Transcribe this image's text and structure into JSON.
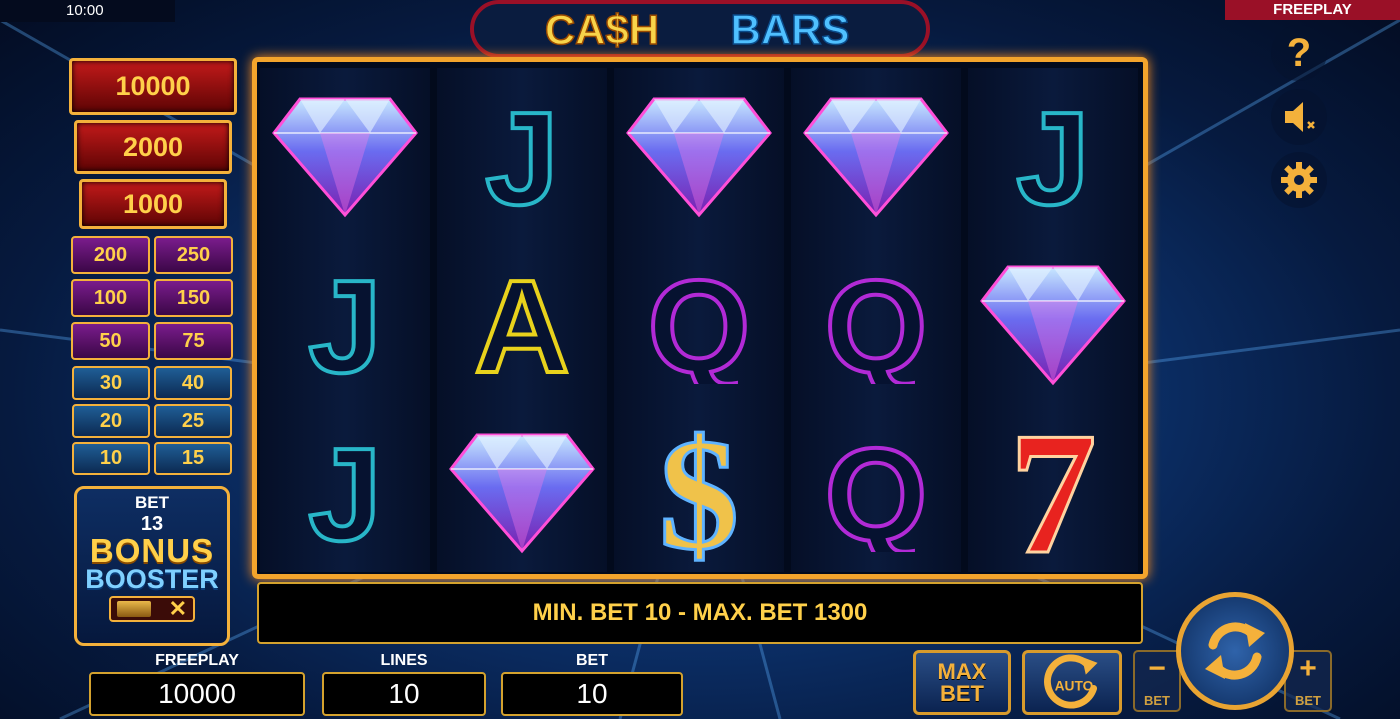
{
  "status": {
    "time": "10:00",
    "mode": "FREEPLAY"
  },
  "logo": {
    "part1": "CA$H",
    "part2": "BARS"
  },
  "paytable": {
    "big": [
      "10000",
      "2000",
      "1000"
    ],
    "pairs": [
      [
        "200",
        "250"
      ],
      [
        "100",
        "150"
      ],
      [
        "50",
        "75"
      ],
      [
        "30",
        "40"
      ],
      [
        "20",
        "25"
      ],
      [
        "10",
        "15"
      ]
    ]
  },
  "reels": [
    [
      "diamond",
      "J",
      "J"
    ],
    [
      "J",
      "A",
      "diamond"
    ],
    [
      "diamond",
      "Q",
      "dollar"
    ],
    [
      "diamond",
      "Q",
      "Q"
    ],
    [
      "J",
      "diamond",
      "seven"
    ]
  ],
  "message": "MIN. BET 10 - MAX. BET 1300",
  "bonus_booster": {
    "bet_label": "BET",
    "bet_value": "13",
    "title1": "BONUS",
    "title2": "BOOSTER",
    "toggle_off": "✕"
  },
  "bottom": {
    "freeplay_label": "FREEPLAY",
    "freeplay_value": "10000",
    "lines_label": "LINES",
    "lines_value": "10",
    "bet_label": "BET",
    "bet_value": "10"
  },
  "buttons": {
    "max1": "MAX",
    "max2": "BET",
    "auto": "AUTO",
    "minus": "−",
    "plus": "+",
    "bet_minus_label": "BET",
    "bet_plus_label": "BET"
  },
  "icons": {
    "help": "?",
    "sound": "sound-muted-icon",
    "settings": "gear-icon"
  },
  "colors": {
    "accent_gold": "#f4b13b",
    "jack": "#28b6c8",
    "queen": "#b22ad6",
    "ace": "#e8d21c",
    "frame": "#f3a42c"
  }
}
